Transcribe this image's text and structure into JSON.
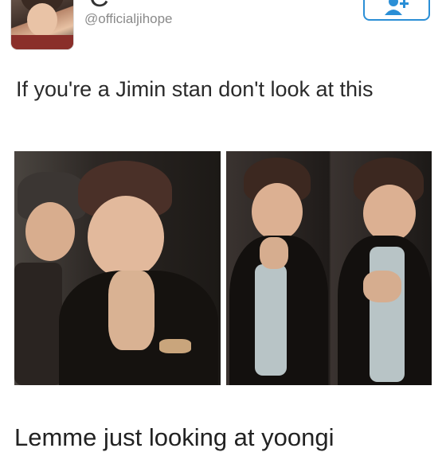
{
  "tweet": {
    "display_name_fragment": "C",
    "handle": "@officialjihope",
    "text": "If you're a Jimin stan don't look at this"
  },
  "follow_button": {
    "icon": "add-user-icon",
    "color": "#2b8fd6"
  },
  "photos": [
    {
      "description_icon": "photo"
    },
    {
      "description_icon": "photo"
    }
  ],
  "next_post": {
    "text_fragment": "Lemme just looking at yoongi"
  }
}
